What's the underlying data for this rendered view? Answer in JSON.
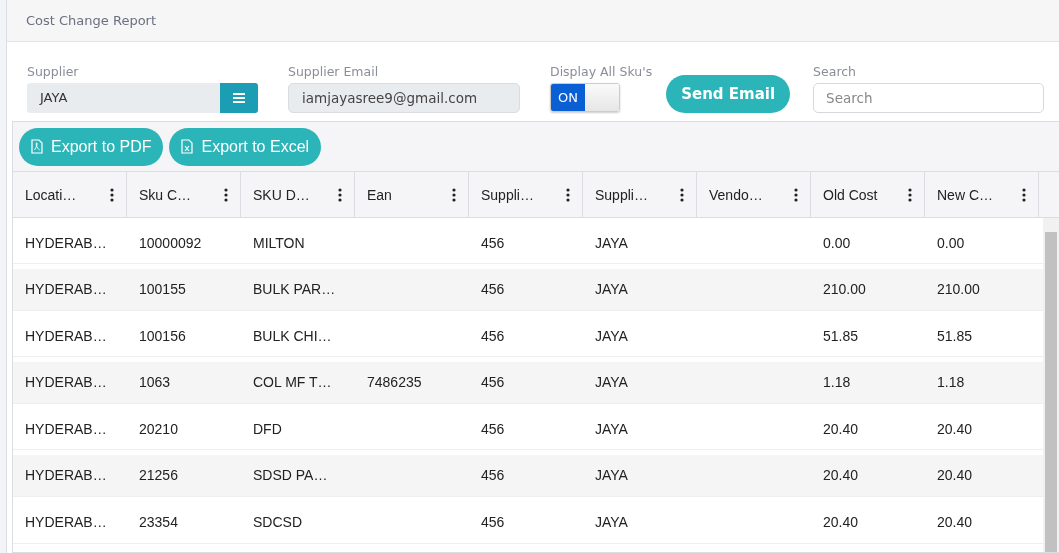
{
  "page_title": "Cost Change Report",
  "filters": {
    "supplier": {
      "label": "Supplier",
      "value": "JAYA"
    },
    "supplier_email": {
      "label": "Supplier Email",
      "value": "iamjayasree9@gmail.com"
    },
    "display_all_skus": {
      "label": "Display All Sku's",
      "on": true,
      "text": "ON"
    },
    "send_button": "Send Email",
    "search": {
      "label": "Search",
      "placeholder": "Search"
    }
  },
  "export_buttons": [
    {
      "kind": "pdf",
      "label": "Export to PDF"
    },
    {
      "kind": "excel",
      "label": "Export to Excel"
    }
  ],
  "table": {
    "columns": [
      "Locati…",
      "Sku C…",
      "SKU D…",
      "Ean",
      "Suppli…",
      "Suppli…",
      "Vendo…",
      "Old Cost",
      "New C…"
    ],
    "rows": [
      [
        "HYDERAB…",
        "10000092",
        "MILTON",
        "",
        "456",
        "JAYA",
        "",
        "0.00",
        "0.00"
      ],
      [
        "HYDERAB…",
        "100155",
        "BULK PAR…",
        "",
        "456",
        "JAYA",
        "",
        "210.00",
        "210.00"
      ],
      [
        "HYDERAB…",
        "100156",
        "BULK CHI…",
        "",
        "456",
        "JAYA",
        "",
        "51.85",
        "51.85"
      ],
      [
        "HYDERAB…",
        "1063",
        "COL MF T…",
        "7486235",
        "456",
        "JAYA",
        "",
        "1.18",
        "1.18"
      ],
      [
        "HYDERAB…",
        "20210",
        "DFD",
        "",
        "456",
        "JAYA",
        "",
        "20.40",
        "20.40"
      ],
      [
        "HYDERAB…",
        "21256",
        "SDSD PA…",
        "",
        "456",
        "JAYA",
        "",
        "20.40",
        "20.40"
      ],
      [
        "HYDERAB…",
        "23354",
        "SDCSD",
        "",
        "456",
        "JAYA",
        "",
        "20.40",
        "20.40"
      ]
    ]
  }
}
